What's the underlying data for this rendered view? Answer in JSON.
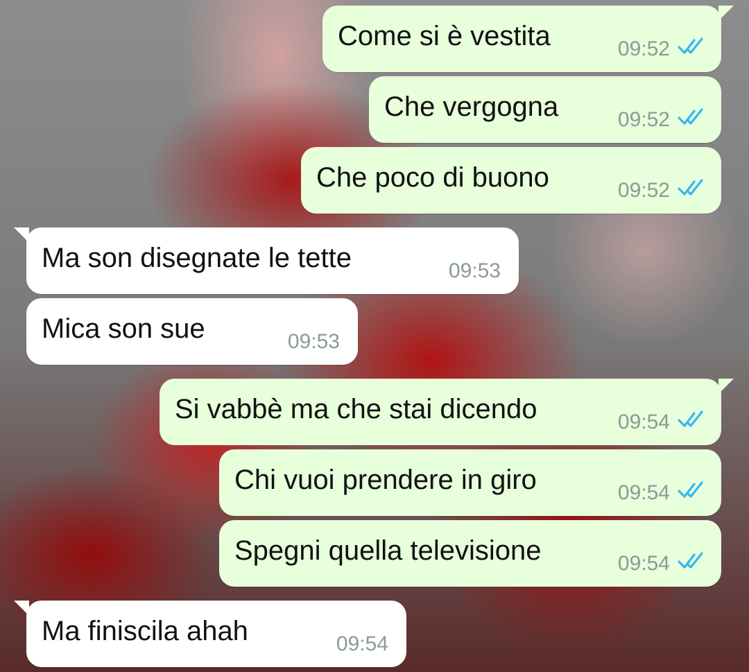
{
  "messages": [
    {
      "direction": "out",
      "text": "Come si è vestita",
      "time": "09:52",
      "status": "read-double-check-icon"
    },
    {
      "direction": "out",
      "text": "Che vergogna",
      "time": "09:52",
      "status": "read-double-check-icon"
    },
    {
      "direction": "out",
      "text": "Che poco di buono",
      "time": "09:52",
      "status": "read-double-check-icon"
    },
    {
      "direction": "in",
      "text": "Ma son disegnate le tette",
      "time": "09:53"
    },
    {
      "direction": "in",
      "text": "Mica son sue",
      "time": "09:53"
    },
    {
      "direction": "out",
      "text": "Si vabbè ma che stai dicendo",
      "time": "09:54",
      "status": "read-double-check-icon"
    },
    {
      "direction": "out",
      "text": "Chi vuoi prendere in giro",
      "time": "09:54",
      "status": "read-double-check-icon"
    },
    {
      "direction": "out",
      "text": "Spegni quella televisione",
      "time": "09:54",
      "status": "read-double-check-icon"
    },
    {
      "direction": "in",
      "text": "Ma finiscila ahah",
      "time": "09:54"
    }
  ],
  "colors": {
    "outgoing_bubble": "#e7ffdb",
    "incoming_bubble": "#ffffff",
    "read_ticks": "#34b7f1",
    "timestamp": "#8b9a95"
  }
}
